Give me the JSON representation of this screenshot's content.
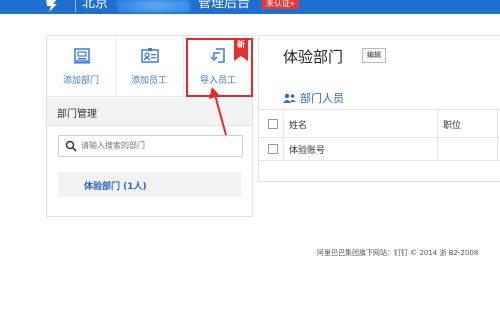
{
  "header": {
    "org_name_visible": "北京",
    "admin_title": "管理后台",
    "verify_badge": "未认证»"
  },
  "left_panel": {
    "actions": [
      {
        "label": "添加部门",
        "icon": "add-department-icon"
      },
      {
        "label": "添加员工",
        "icon": "add-employee-icon"
      },
      {
        "label": "导入员工",
        "icon": "import-employee-icon",
        "tag": "新"
      }
    ],
    "dept_management": {
      "title": "部门管理",
      "search_placeholder": "请输入搜索的部门",
      "items": [
        {
          "label": "体验部门 (1人)"
        }
      ]
    }
  },
  "right_panel": {
    "title": "体验部门",
    "edit_label": "编辑",
    "members_title": "部门人员",
    "table": {
      "columns": [
        "姓名",
        "职位"
      ],
      "rows": [
        {
          "name": "体验账号",
          "position": ""
        }
      ]
    }
  },
  "footer": "阿里巴巴集团旗下网站：钉钉 © 2014 浙 B2-2008",
  "colors": {
    "brand": "#1f6fd1",
    "link": "#3a7bd5",
    "alert": "#e23131"
  }
}
